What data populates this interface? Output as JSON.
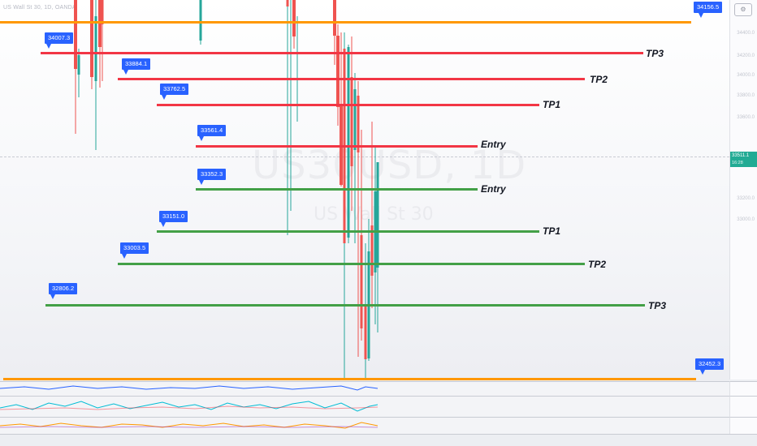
{
  "symbol_header": "US Wall St 30, 1D, OANDA",
  "watermark": {
    "main": "US30USD, 1D",
    "sub": "US Wall St 30"
  },
  "price_scale": {
    "ticks": [
      "34400.0",
      "34200.0",
      "34000.0",
      "33800.0",
      "33600.0",
      "33200.0",
      "33000.0"
    ],
    "current_price": "33511.1",
    "countdown": "16:28"
  },
  "settings_icon": "gear-icon",
  "levels": {
    "top_orange": {
      "value": "34156.5",
      "color": "#ff9800"
    },
    "bottom_orange": {
      "value": "32452.3",
      "color": "#ff9800"
    },
    "sell": [
      {
        "value": "34007.3",
        "label": "TP3"
      },
      {
        "value": "33884.1",
        "label": "TP2"
      },
      {
        "value": "33762.5",
        "label": "TP1"
      },
      {
        "value": "33561.4",
        "label": "Entry"
      }
    ],
    "buy": [
      {
        "value": "33352.3",
        "label": "Entry"
      },
      {
        "value": "33151.0",
        "label": "TP1"
      },
      {
        "value": "33003.5",
        "label": "TP2"
      },
      {
        "value": "32806.2",
        "label": "TP3"
      }
    ]
  },
  "colors": {
    "sell_line": "#f23645",
    "buy_line": "#43a047",
    "tag": "#2962ff",
    "up_candle": "#26a69a",
    "down_candle": "#ef5350"
  }
}
